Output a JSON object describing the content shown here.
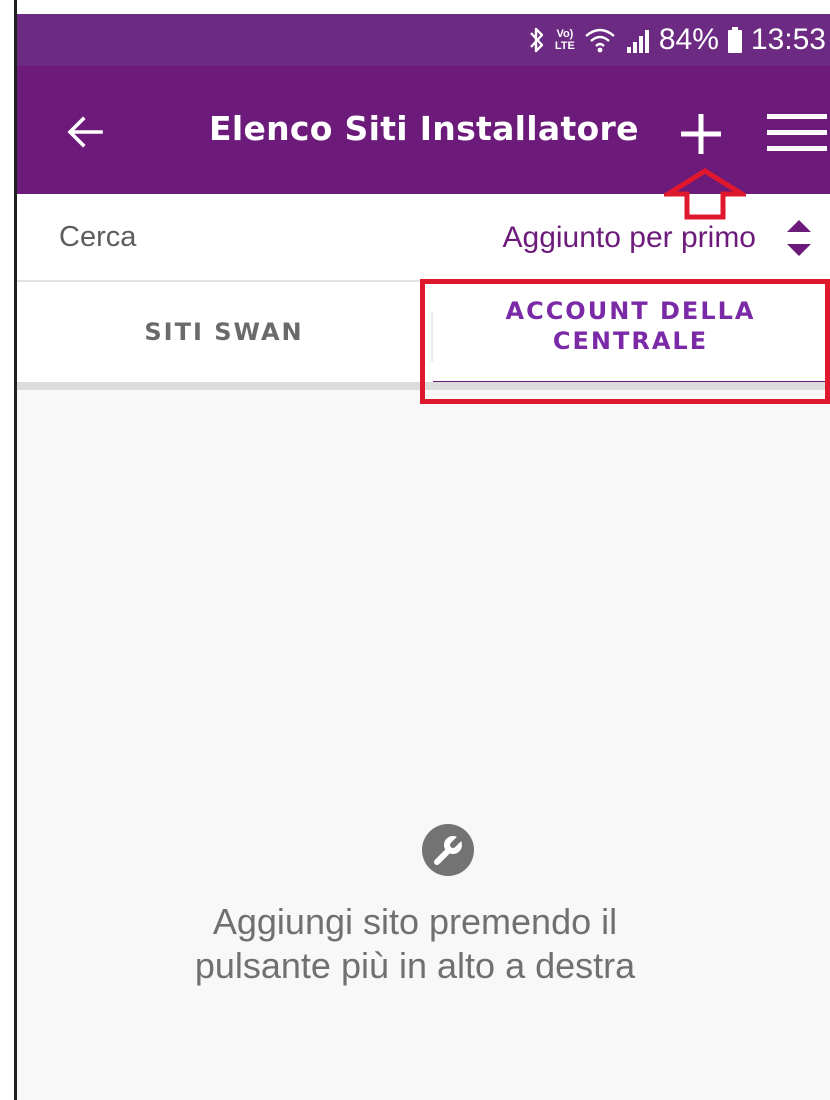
{
  "status_bar": {
    "battery_percent": "84%",
    "time": "13:53",
    "network_label_top": "Vo)",
    "network_label_bottom": "LTE"
  },
  "app_bar": {
    "title": "Elenco Siti Installatore",
    "icons": [
      "back-arrow-icon",
      "plus-icon",
      "hamburger-menu-icon"
    ]
  },
  "search": {
    "placeholder": "Cerca",
    "sort_label": "Aggiunto per primo"
  },
  "tabs": [
    {
      "label": "SITI SWAN",
      "active": false
    },
    {
      "label": "ACCOUNT DELLA CENTRALE",
      "active": true
    }
  ],
  "empty_state": {
    "icon": "wrench-icon",
    "message": "Aggiungi sito premendo il pulsante più in alto a destra"
  },
  "colors": {
    "status_bar": "#6d2a82",
    "app_bar": "#6d1b7b",
    "accent": "#7b2aa7",
    "annotation": "#e0182e",
    "content_bg": "#f8f8f8"
  }
}
